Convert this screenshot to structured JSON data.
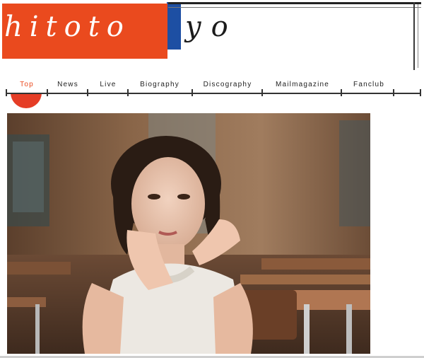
{
  "brand": {
    "logo_left": "hitoto",
    "logo_right": "yo",
    "accent_color": "#ea4a1e",
    "blue_color": "#1d4fa3"
  },
  "nav": {
    "items": [
      {
        "label": "Top",
        "active": true
      },
      {
        "label": "News",
        "active": false
      },
      {
        "label": "Live",
        "active": false
      },
      {
        "label": "Biography",
        "active": false
      },
      {
        "label": "Discography",
        "active": false
      },
      {
        "label": "Mailmagazine",
        "active": false
      },
      {
        "label": "Fanclub",
        "active": false
      }
    ]
  },
  "main": {
    "hero_image": "portrait-photo"
  }
}
